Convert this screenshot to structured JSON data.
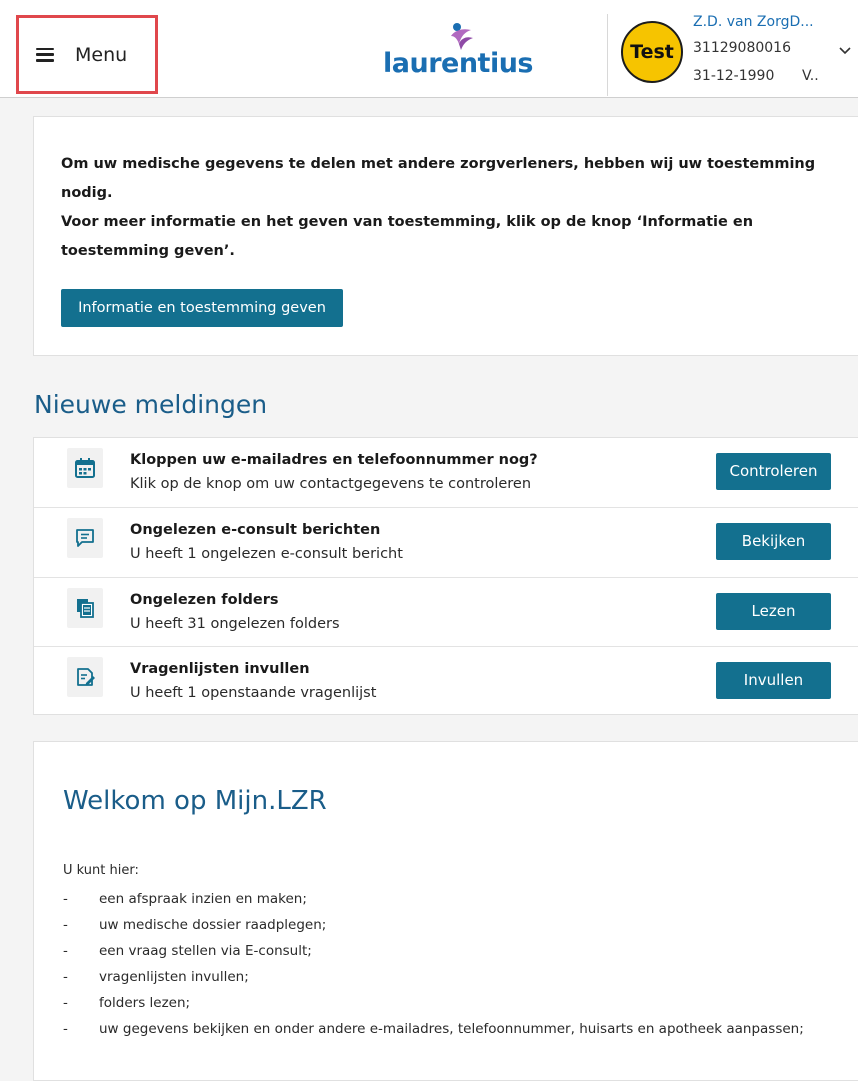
{
  "header": {
    "menu_label": "Menu",
    "logo_text": "laurentius",
    "user": {
      "avatar_label": "Test",
      "name": "Z.D. van ZorgD...",
      "patient_number": "31129080016",
      "birth_date": "31-12-1990",
      "sex": "V.."
    }
  },
  "consent": {
    "line1": "Om uw medische gegevens te delen met andere zorgverleners, hebben wij uw toestemming nodig.",
    "line2": "Voor meer informatie en het geven van toestemming, klik op de knop ‘Informatie en toestemming geven’.",
    "button_label": "Informatie en toestemming geven"
  },
  "notifications": {
    "title": "Nieuwe meldingen",
    "items": [
      {
        "icon": "calendar-icon",
        "title": "Kloppen uw e-mailadres en telefoonnummer nog?",
        "subtitle": "Klik op de knop om uw contactgegevens te controleren",
        "button": "Controleren"
      },
      {
        "icon": "chat-icon",
        "title": "Ongelezen e-consult berichten",
        "subtitle": "U heeft 1 ongelezen e-consult bericht",
        "button": "Bekijken"
      },
      {
        "icon": "documents-icon",
        "title": "Ongelezen folders",
        "subtitle": "U heeft 31 ongelezen folders",
        "button": "Lezen"
      },
      {
        "icon": "edit-document-icon",
        "title": "Vragenlijsten invullen",
        "subtitle": "U heeft 1 openstaande vragenlijst",
        "button": "Invullen"
      }
    ]
  },
  "welcome": {
    "title": "Welkom op Mijn.LZR",
    "intro": "U kunt hier:",
    "dash": "-",
    "items": [
      "een afspraak inzien en maken;",
      "uw medische dossier raadplegen;",
      "een vraag stellen via E-consult;",
      "vragenlijsten invullen;",
      "folders lezen;",
      "uw gegevens bekijken en onder andere e-mailadres, telefoonnummer, huisarts en apotheek aanpassen;"
    ]
  },
  "colors": {
    "primary_button": "#13708f",
    "heading": "#1a5d89",
    "link": "#1a6eb2",
    "avatar": "#f6c400",
    "highlight_border": "#e0474c"
  }
}
